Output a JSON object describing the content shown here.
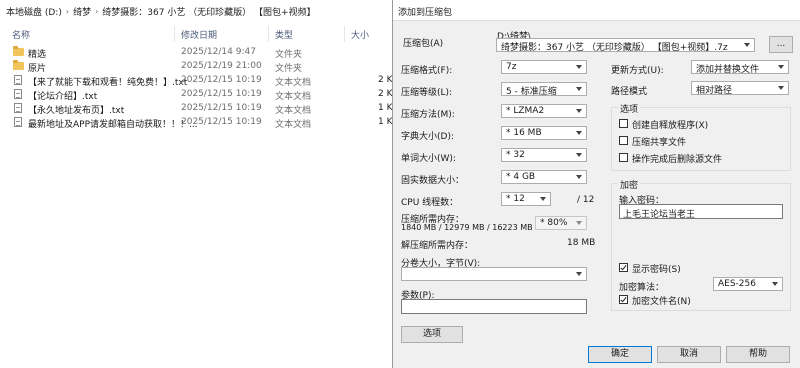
{
  "explorer": {
    "breadcrumb": [
      "本地磁盘 (D:)",
      "绮梦",
      "绮梦摄影：367 小艺 （无印珍藏版） 【图包+视频】"
    ],
    "columns": {
      "name": "名称",
      "date": "修改日期",
      "type": "类型",
      "size": "大小"
    },
    "files": [
      {
        "name": "精选",
        "date": "2025/12/14 9:47",
        "type": "文件夹",
        "size": "",
        "kind": "folder"
      },
      {
        "name": "原片",
        "date": "2025/12/19 21:00",
        "type": "文件夹",
        "size": "",
        "kind": "folder"
      },
      {
        "name": "【来了就能下载和观看！纯免费！】.txt",
        "date": "2025/12/15 10:19",
        "type": "文本文档",
        "size": "2 K",
        "kind": "txt"
      },
      {
        "name": "【论坛介绍】.txt",
        "date": "2025/12/15 10:19",
        "type": "文本文档",
        "size": "2 K",
        "kind": "txt"
      },
      {
        "name": "【永久地址发布页】.txt",
        "date": "2025/12/15 10:19",
        "type": "文本文档",
        "size": "1 K",
        "kind": "txt"
      },
      {
        "name": "最新地址及APP请发邮箱自动获取！！！...",
        "date": "2025/12/15 10:19",
        "type": "文本文档",
        "size": "1 K",
        "kind": "txt"
      }
    ]
  },
  "dialog": {
    "title": "添加到压缩包",
    "archive_label": "压缩包(A)",
    "archive_path": "D:\\绮梦\\",
    "archive_name": "绮梦摄影：367 小艺 （无印珍藏版） 【图包+视频】.7z",
    "browse_label": "...",
    "format_label": "压缩格式(F):",
    "format_value": "7z",
    "level_label": "压缩等级(L):",
    "level_value": "5 - 标准压缩",
    "method_label": "压缩方法(M):",
    "method_value": "* LZMA2",
    "dict_label": "字典大小(D):",
    "dict_value": "* 16 MB",
    "word_label": "单词大小(W):",
    "word_value": "* 32",
    "solid_label": "固实数据大小：",
    "solid_value": "* 4 GB",
    "threads_label": "CPU 线程数：",
    "threads_value": "* 12",
    "threads_total": "/ 12",
    "mem_label": "压缩所需内存：",
    "mem_detail": "1840 MB / 12979 MB / 16223 MB",
    "mem_percent": "* 80%",
    "decomp_label": "解压缩所需内存：",
    "decomp_value": "18 MB",
    "split_label": "分卷大小，字节(V):",
    "params_label": "参数(P):",
    "options_btn": "选项",
    "update_label": "更新方式(U):",
    "update_value": "添加并替换文件",
    "path_label": "路径模式",
    "path_value": "相对路径",
    "options_group": "选项",
    "opt_sfx": "创建自释放程序(X)",
    "opt_shared": "压缩共享文件",
    "opt_delete": "操作完成后删除源文件",
    "encrypt_group": "加密",
    "password_label": "输入密码：",
    "password_value": "上毛王论坛当老王",
    "show_password": "显示密码(S)",
    "enc_method_label": "加密算法：",
    "enc_method_value": "AES-256",
    "encrypt_names": "加密文件名(N)",
    "ok": "确定",
    "cancel": "取消",
    "help": "帮助"
  }
}
